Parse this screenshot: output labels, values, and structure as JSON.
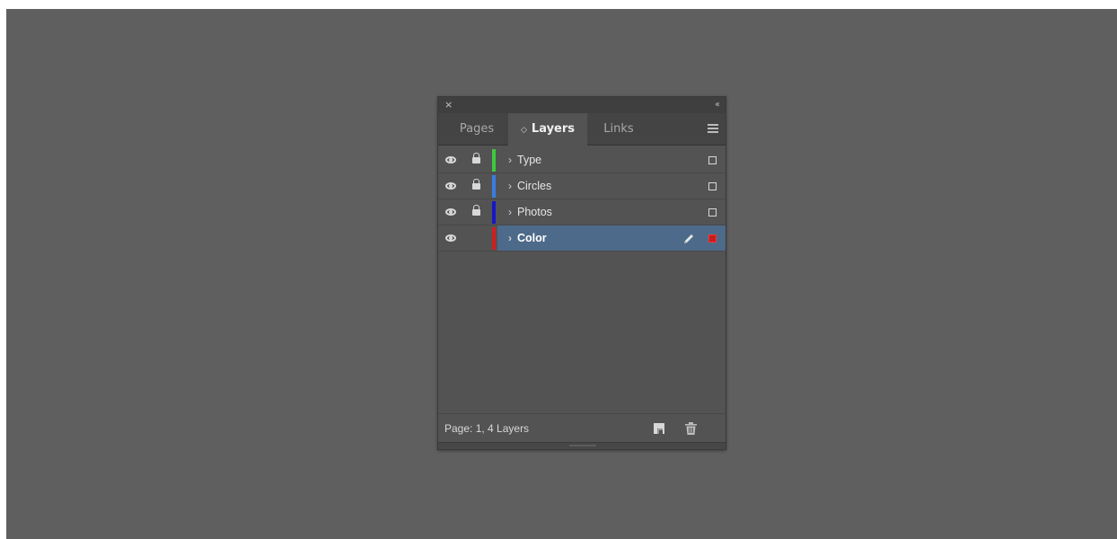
{
  "panel": {
    "close_glyph": "×",
    "collapse_glyph": "‹‹",
    "tabs": [
      {
        "label": "Pages",
        "active": false
      },
      {
        "label": "Layers",
        "active": true
      },
      {
        "label": "Links",
        "active": false
      }
    ],
    "tab_arrows_glyph": "◇"
  },
  "layers": [
    {
      "name": "Type",
      "color": "#3ec93e",
      "visible": true,
      "locked": true,
      "selected": false
    },
    {
      "name": "Circles",
      "color": "#3a7de0",
      "visible": true,
      "locked": true,
      "selected": false
    },
    {
      "name": "Photos",
      "color": "#1616c8",
      "visible": true,
      "locked": true,
      "selected": false
    },
    {
      "name": "Color",
      "color": "#d21e1e",
      "visible": true,
      "locked": false,
      "selected": true
    }
  ],
  "footer": {
    "status": "Page: 1, 4 Layers"
  },
  "icons": {
    "eye": "eye-icon",
    "lock": "lock-icon",
    "pen": "pen-icon",
    "new_layer": "new-layer-icon",
    "trash": "trash-icon",
    "menu": "hamburger-menu-icon"
  },
  "colors": {
    "workspace": "#5f5f5f",
    "panel": "#535353",
    "selection": "#4d6a8a"
  }
}
